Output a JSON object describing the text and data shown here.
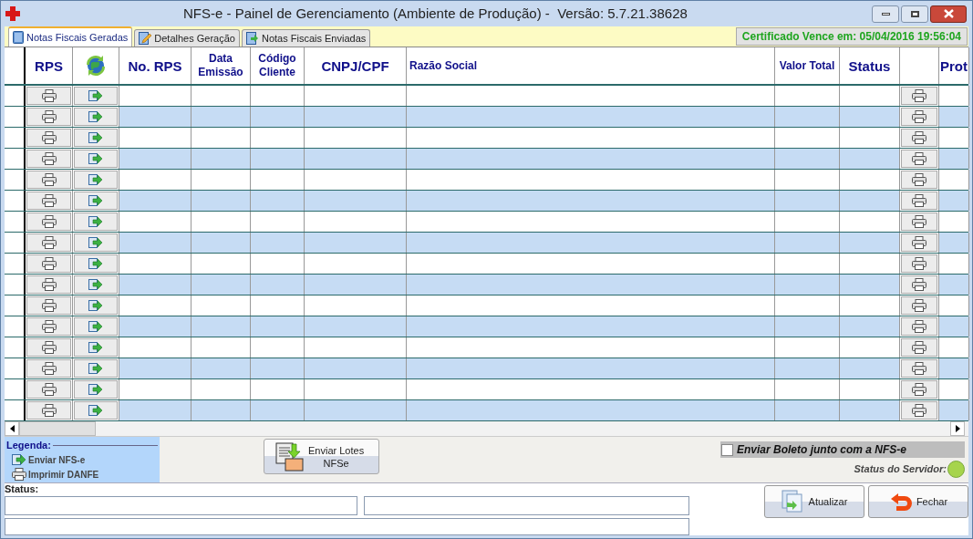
{
  "window": {
    "title": "NFS-e - Painel de Gerenciamento (Ambiente de Produção) -  Versão: 5.7.21.38628"
  },
  "tabs": [
    {
      "label": "Notas Fiscais Geradas",
      "selected": true,
      "kind": "book"
    },
    {
      "label": "Detalhes Geração",
      "selected": false,
      "kind": "edit"
    },
    {
      "label": "Notas Fiscais Enviadas",
      "selected": false,
      "kind": "send"
    }
  ],
  "certificate": "Certificado Vence em: 05/04/2016 19:56:04",
  "table": {
    "columns": [
      {
        "label": "RPS",
        "kind": "big"
      },
      {
        "kind": "globe"
      },
      {
        "label": "No. RPS",
        "kind": "big"
      },
      {
        "label": "Data Emissão",
        "kind": "small"
      },
      {
        "label": "Código Cliente",
        "kind": "small"
      },
      {
        "label": "CNPJ/CPF",
        "kind": "big"
      },
      {
        "label": "Razão Social",
        "kind": "left"
      },
      {
        "label": "Valor Total",
        "kind": "small"
      },
      {
        "label": "Status",
        "kind": "big"
      },
      {
        "kind": "blank"
      },
      {
        "label": "Prot",
        "kind": "big"
      }
    ],
    "rows": [
      {
        "kind": "blank"
      },
      {
        "kind": "blank"
      },
      {
        "kind": "blank"
      },
      {
        "kind": "blank"
      },
      {
        "kind": "blank"
      },
      {
        "kind": "blank"
      },
      {
        "kind": "blank"
      },
      {
        "kind": "blank"
      },
      {
        "kind": "blank"
      },
      {
        "kind": "blank"
      },
      {
        "kind": "blank"
      },
      {
        "kind": "blank"
      },
      {
        "kind": "blank"
      },
      {
        "kind": "blank"
      },
      {
        "kind": "blank"
      },
      {
        "kind": "blank"
      }
    ]
  },
  "legend": {
    "title": "Legenda:",
    "items": [
      {
        "label": "Enviar NFS-e",
        "kind": "send"
      },
      {
        "label": "Imprimir DANFE",
        "kind": "print"
      }
    ]
  },
  "send_button": {
    "line1": "Enviar Lotes",
    "line2": "NFSe"
  },
  "boleto_checkbox": {
    "label": "Enviar Boleto junto com a NFS-e",
    "checked": false
  },
  "server_status": {
    "label": "Status do Servidor:"
  },
  "status_label": "Status:",
  "buttons": [
    {
      "label": "Atualizar",
      "kind": "refresh"
    },
    {
      "label": "Fechar",
      "kind": "close"
    }
  ]
}
